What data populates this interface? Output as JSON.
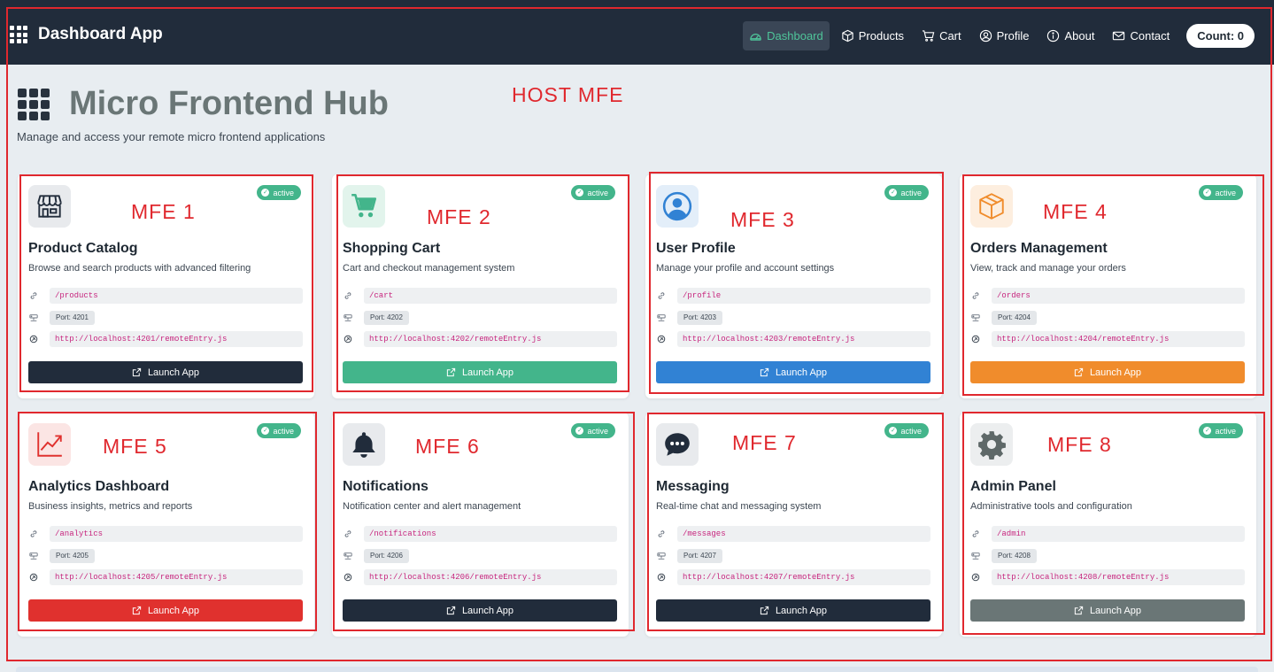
{
  "navbar": {
    "brand": "Dashboard App",
    "items": [
      {
        "label": "Dashboard",
        "icon": "speedometer-icon",
        "active": true
      },
      {
        "label": "Products",
        "icon": "box-icon",
        "active": false
      },
      {
        "label": "Cart",
        "icon": "cart-icon",
        "active": false
      },
      {
        "label": "Profile",
        "icon": "person-circle-icon",
        "active": false
      },
      {
        "label": "About",
        "icon": "info-circle-icon",
        "active": false
      },
      {
        "label": "Contact",
        "icon": "envelope-icon",
        "active": false
      }
    ],
    "count": "Count: 0"
  },
  "hub": {
    "title": "Micro Frontend Hub",
    "subtitle": "Manage and access your remote micro frontend applications"
  },
  "annotations": {
    "host": "HOST MFE",
    "mfes": [
      "MFE 1",
      "MFE 2",
      "MFE 3",
      "MFE 4",
      "MFE 5",
      "MFE 6",
      "MFE 7",
      "MFE 8"
    ],
    "color": "#e0282e"
  },
  "cards": [
    {
      "title": "Product Catalog",
      "desc": "Browse and search products with advanced filtering",
      "route": "/products",
      "port": "Port: 4201",
      "remote": "http://localhost:4201/remoteEntry.js",
      "status": "active",
      "launch": "Launch App",
      "icon": "storefront-icon",
      "color": "#212c3b",
      "icon_bg": "#e8eaed",
      "icon_color": "#212c3b"
    },
    {
      "title": "Shopping Cart",
      "desc": "Cart and checkout management system",
      "route": "/cart",
      "port": "Port: 4202",
      "remote": "http://localhost:4202/remoteEntry.js",
      "status": "active",
      "launch": "Launch App",
      "icon": "cart-icon",
      "color": "#43b58b",
      "icon_bg": "#e2f4ec",
      "icon_color": "#43b58b"
    },
    {
      "title": "User Profile",
      "desc": "Manage your profile and account settings",
      "route": "/profile",
      "port": "Port: 4203",
      "remote": "http://localhost:4203/remoteEntry.js",
      "status": "active",
      "launch": "Launch App",
      "icon": "person-circle-icon",
      "color": "#3182d4",
      "icon_bg": "#e3eef9",
      "icon_color": "#3182d4"
    },
    {
      "title": "Orders Management",
      "desc": "View, track and manage your orders",
      "route": "/orders",
      "port": "Port: 4204",
      "remote": "http://localhost:4204/remoteEntry.js",
      "status": "active",
      "launch": "Launch App",
      "icon": "box-icon",
      "color": "#f08c2c",
      "icon_bg": "#fdeedf",
      "icon_color": "#f08c2c"
    },
    {
      "title": "Analytics Dashboard",
      "desc": "Business insights, metrics and reports",
      "route": "/analytics",
      "port": "Port: 4205",
      "remote": "http://localhost:4205/remoteEntry.js",
      "status": "active",
      "launch": "Launch App",
      "icon": "graph-up-icon",
      "color": "#e0312e",
      "icon_bg": "#fbe5e4",
      "icon_color": "#e0312e"
    },
    {
      "title": "Notifications",
      "desc": "Notification center and alert management",
      "route": "/notifications",
      "port": "Port: 4206",
      "remote": "http://localhost:4206/remoteEntry.js",
      "status": "active",
      "launch": "Launch App",
      "icon": "bell-icon",
      "color": "#212c3b",
      "icon_bg": "#e8eaed",
      "icon_color": "#212c3b"
    },
    {
      "title": "Messaging",
      "desc": "Real-time chat and messaging system",
      "route": "/messages",
      "port": "Port: 4207",
      "remote": "http://localhost:4207/remoteEntry.js",
      "status": "active",
      "launch": "Launch App",
      "icon": "chat-dots-icon",
      "color": "#212c3b",
      "icon_bg": "#e8eaed",
      "icon_color": "#212c3b"
    },
    {
      "title": "Admin Panel",
      "desc": "Administrative tools and configuration",
      "route": "/admin",
      "port": "Port: 4208",
      "remote": "http://localhost:4208/remoteEntry.js",
      "status": "active",
      "launch": "Launch App",
      "icon": "gear-icon",
      "color": "#6a7676",
      "icon_bg": "#eceeef",
      "icon_color": "#5e6868"
    }
  ]
}
